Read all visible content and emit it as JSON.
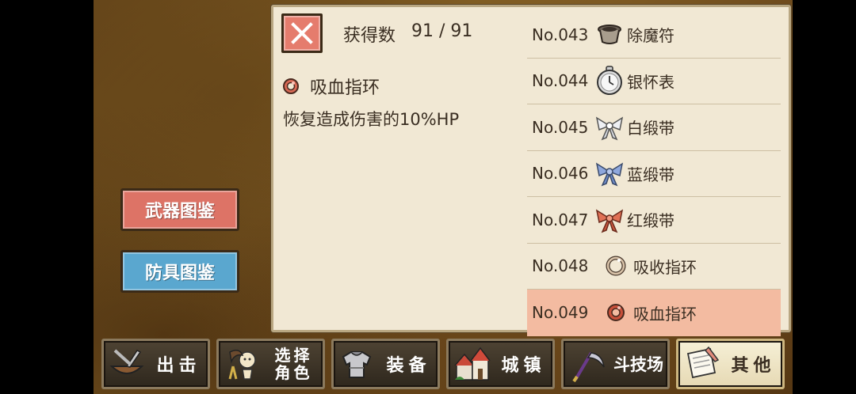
{
  "collection": {
    "count_label": "获得数",
    "count_value": "91 / 91"
  },
  "selected_item": {
    "name": "吸血指环",
    "description": "恢复造成伤害的10%HP",
    "icon": "red-ring-icon"
  },
  "side_buttons": {
    "weapon_label": "武器图鉴",
    "armor_label": "防具图鉴"
  },
  "items": [
    {
      "no": "No.043",
      "name": "除魔符",
      "icon": "pot-icon"
    },
    {
      "no": "No.044",
      "name": "银怀表",
      "icon": "pocket-watch-icon"
    },
    {
      "no": "No.045",
      "name": "白缎带",
      "icon": "white-ribbon-icon"
    },
    {
      "no": "No.046",
      "name": "蓝缎带",
      "icon": "blue-ribbon-icon"
    },
    {
      "no": "No.047",
      "name": "红缎带",
      "icon": "red-ribbon-icon"
    },
    {
      "no": "No.048",
      "name": "吸收指环",
      "icon": "silver-ring-icon"
    },
    {
      "no": "No.049",
      "name": "吸血指环",
      "icon": "red-ring-icon"
    }
  ],
  "tabs": [
    {
      "label": "出击",
      "icon": "boat-icon"
    },
    {
      "label": "选择角色",
      "line1": "选择",
      "line2": "角色",
      "icon": "character-icon"
    },
    {
      "label": "装备",
      "icon": "armor-icon"
    },
    {
      "label": "城镇",
      "icon": "town-icon"
    },
    {
      "label": "斗技场",
      "icon": "scythe-icon"
    },
    {
      "label": "其他",
      "icon": "scroll-icon"
    }
  ],
  "colors": {
    "weapon_button": "#dd7366",
    "armor_button": "#5aa7cf",
    "selected_row": "#f3bba1",
    "panel_bg": "#f1e8d4"
  }
}
